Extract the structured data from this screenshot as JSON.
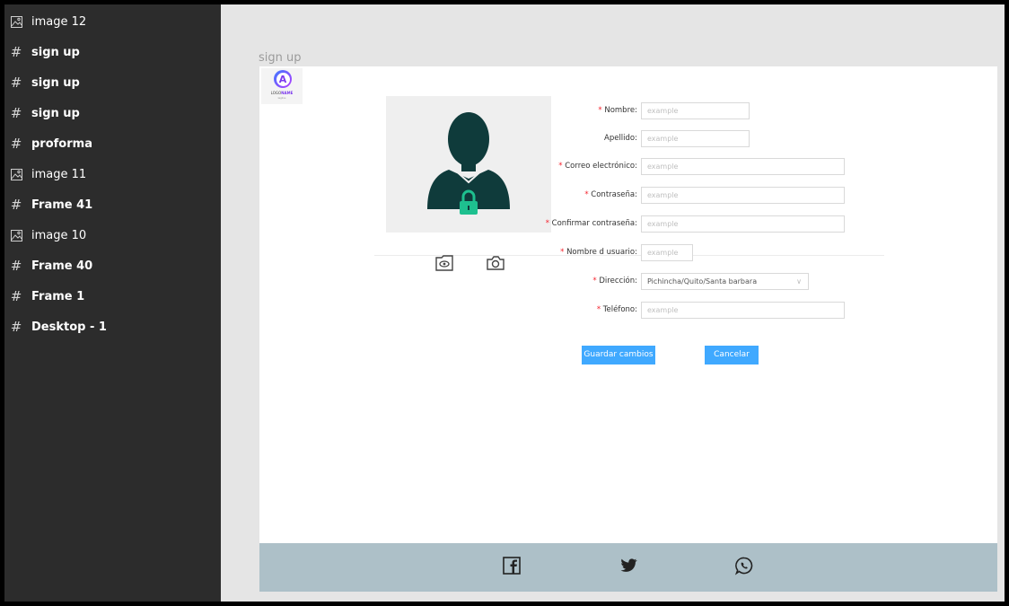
{
  "layers": [
    {
      "label": "image 12",
      "icon": "image-icon"
    },
    {
      "label": "sign up",
      "icon": "frame-icon"
    },
    {
      "label": "sign up",
      "icon": "frame-icon"
    },
    {
      "label": "sign up",
      "icon": "frame-icon"
    },
    {
      "label": "proforma",
      "icon": "frame-icon"
    },
    {
      "label": "image 11",
      "icon": "image-icon"
    },
    {
      "label": "Frame 41",
      "icon": "frame-icon"
    },
    {
      "label": "image 10",
      "icon": "image-icon"
    },
    {
      "label": "Frame 40",
      "icon": "frame-icon"
    },
    {
      "label": "Frame 1",
      "icon": "frame-icon"
    },
    {
      "label": "Desktop - 1",
      "icon": "frame-icon"
    }
  ],
  "canvas": {
    "frame_title": "sign up"
  },
  "logo": {
    "mark": "A",
    "text_a": "LOGO",
    "text_b": "NAME",
    "tagline": "tagline"
  },
  "form": {
    "nombre": {
      "label": "Nombre",
      "placeholder": "example"
    },
    "apellido": {
      "label": "Apellido",
      "placeholder": "example"
    },
    "correo": {
      "label": "Correo electrónico",
      "placeholder": "example"
    },
    "contrasena": {
      "label": "Contraseña",
      "placeholder": "example"
    },
    "confirmar": {
      "label": "Confirmar contraseña",
      "placeholder": "example"
    },
    "usuario": {
      "label": "Nombre d usuario",
      "placeholder": "example"
    },
    "direccion": {
      "label": "Dirección",
      "value": "Pichincha/Quito/Santa barbara"
    },
    "telefono": {
      "label": "Teléfono",
      "placeholder": "example"
    },
    "colon": ":",
    "star": "*"
  },
  "buttons": {
    "save": "Guardar cambios",
    "cancel": "Cancelar"
  },
  "colors": {
    "sidebar": "#2c2c2c",
    "primary": "#40a9ff",
    "avatar": "#0f3b3b",
    "lock": "#1ec08f",
    "footer": "#adc0c8"
  }
}
